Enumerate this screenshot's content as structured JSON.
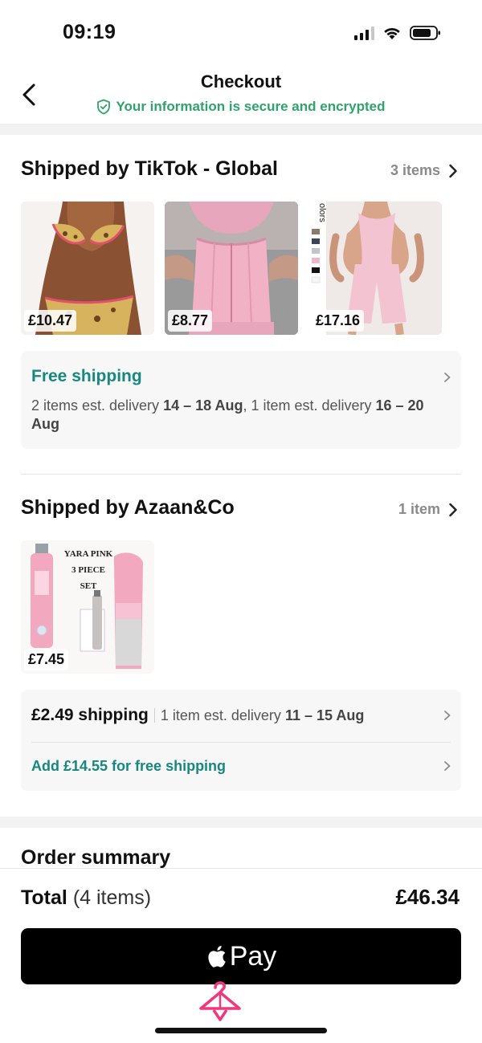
{
  "status_bar": {
    "time": "09:19"
  },
  "header": {
    "title": "Checkout",
    "secure_text": "Your information is secure and encrypted"
  },
  "colors": {
    "accent": "#17877f",
    "secure": "#2fa36b",
    "muted": "#8a8a8a",
    "brand_pink": "#f0387d"
  },
  "shipments": [
    {
      "title": "Shipped by TikTok - Global",
      "items_count": "3 items",
      "products": [
        {
          "price": "£10.47"
        },
        {
          "price": "£8.77"
        },
        {
          "price": "£17.16",
          "overlay_text": "olors"
        }
      ],
      "shipping_title": "Free shipping",
      "delivery": {
        "part1": "2 items est. delivery ",
        "range1": "14 – 18 Aug",
        "part2": ", 1 item est. delivery ",
        "range2": "16 – 20 Aug"
      }
    },
    {
      "title": "Shipped by Azaan&Co",
      "items_count": "1 item",
      "products": [
        {
          "price": "£7.45",
          "image_text": [
            "YARA PINK",
            "3 PIECE",
            "SET"
          ]
        }
      ],
      "shipping_cost": "£2.49 shipping",
      "delivery": {
        "part1": "1 item est. delivery ",
        "range1": "11 – 15 Aug"
      },
      "free_shipping_prompt": "Add £14.55 for free shipping"
    }
  ],
  "order_summary": {
    "title": "Order summary"
  },
  "total": {
    "label": "Total",
    "count": "(4 items)",
    "value": "£46.34"
  },
  "pay_button": {
    "label": "Pay"
  }
}
